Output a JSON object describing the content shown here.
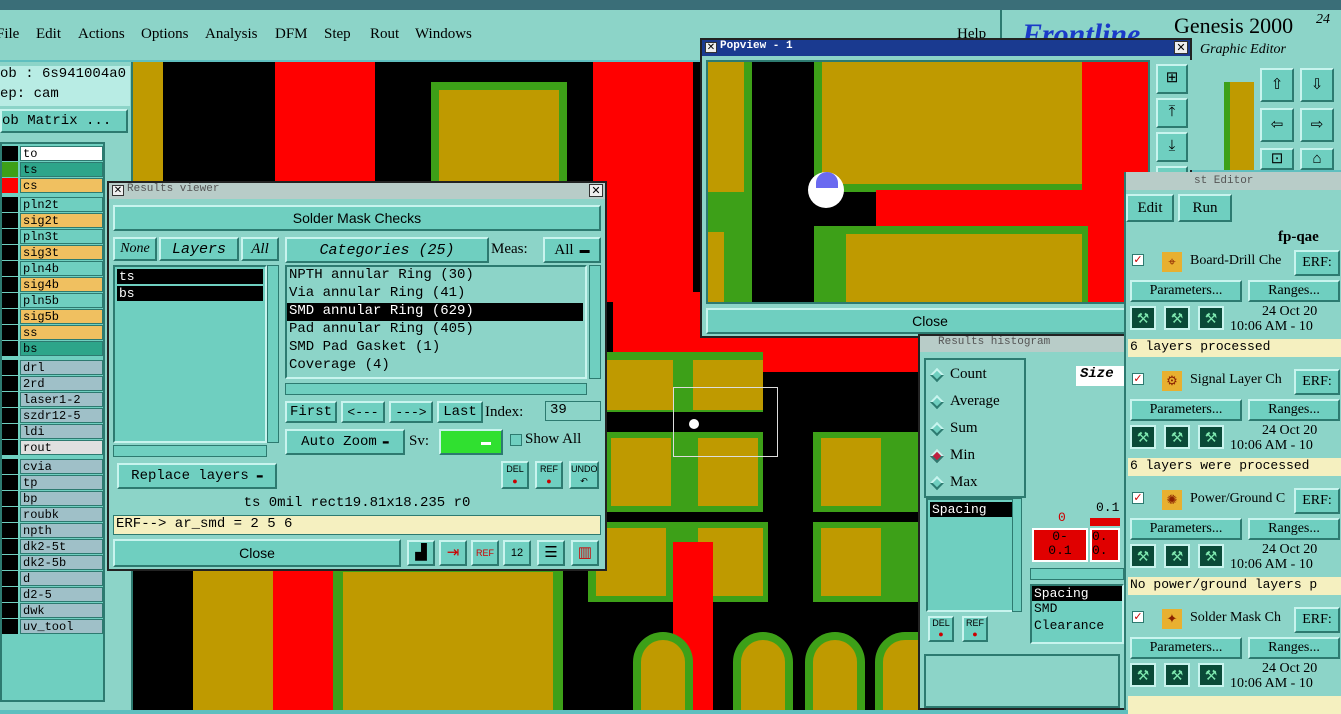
{
  "menubar": {
    "items": [
      "File",
      "Edit",
      "Actions",
      "Options",
      "Analysis",
      "DFM",
      "Step",
      "Rout",
      "Windows"
    ],
    "help": "Help"
  },
  "brand": {
    "logo": "Frontline",
    "product": "Genesis 2000",
    "version": "24",
    "sub": "Graphic Editor"
  },
  "job": {
    "job": "ob : 6s941004a0",
    "step": "ep: cam",
    "matrix": "ob Matrix ..."
  },
  "layers": [
    {
      "name": "to",
      "color": "#ffffff"
    },
    {
      "name": "ts",
      "color": "#2da58a"
    },
    {
      "name": "cs",
      "color": "#f0c060"
    },
    {
      "name": "pln2t",
      "color": "#6fcfc0"
    },
    {
      "name": "sig2t",
      "color": "#f0c060"
    },
    {
      "name": "pln3t",
      "color": "#6fcfc0"
    },
    {
      "name": "sig3t",
      "color": "#f0c060"
    },
    {
      "name": "pln4b",
      "color": "#6fcfc0"
    },
    {
      "name": "sig4b",
      "color": "#f0c060"
    },
    {
      "name": "pln5b",
      "color": "#6fcfc0"
    },
    {
      "name": "sig5b",
      "color": "#f0c060"
    },
    {
      "name": "ss",
      "color": "#f0c060"
    },
    {
      "name": "bs",
      "color": "#2da58a"
    },
    {
      "name": "drl",
      "color": "#9fc0c8"
    },
    {
      "name": "2rd",
      "color": "#9fc0c8"
    },
    {
      "name": "laser1-2",
      "color": "#9fc0c8"
    },
    {
      "name": "szdr12-5",
      "color": "#9fc0c8"
    },
    {
      "name": "ldi",
      "color": "#9fc0c8"
    },
    {
      "name": "rout",
      "color": "#e0e0e0"
    },
    {
      "name": "cvia",
      "color": "#9fc0c8"
    },
    {
      "name": "tp",
      "color": "#9fc0c8"
    },
    {
      "name": "bp",
      "color": "#9fc0c8"
    },
    {
      "name": "roubk",
      "color": "#9fc0c8"
    },
    {
      "name": "npth",
      "color": "#9fc0c8"
    },
    {
      "name": "dk2-5t",
      "color": "#9fc0c8"
    },
    {
      "name": "dk2-5b",
      "color": "#9fc0c8"
    },
    {
      "name": "d",
      "color": "#9fc0c8"
    },
    {
      "name": "d2-5",
      "color": "#9fc0c8"
    },
    {
      "name": "dwk",
      "color": "#9fc0c8"
    },
    {
      "name": "uv_tool",
      "color": "#9fc0c8"
    }
  ],
  "results_viewer": {
    "title": "Results viewer",
    "header": "Solder Mask Checks",
    "none": "None",
    "layers_label": "Layers",
    "all": "All",
    "layer_list": [
      "ts",
      "bs"
    ],
    "categories_label": "Categories (25)",
    "meas_label": "Meas:",
    "meas_value": "All",
    "categories": [
      "NPTH annular Ring (30)",
      "Via annular Ring (41)",
      "SMD annular Ring (629)",
      "Pad annular Ring (405)",
      "SMD Pad Gasket (1)",
      "Coverage (4)"
    ],
    "first": "First",
    "prev": "<---",
    "next": "--->",
    "last": "Last",
    "index_label": "Index:",
    "index_value": "39",
    "auto_zoom": "Auto Zoom",
    "sv_label": "Sv:",
    "show_all": "Show All",
    "replace_layers": "Replace layers",
    "del": "DEL",
    "ref": "REF",
    "undo": "UNDO",
    "status": "ts 0mil   rect19.81x18.235  r0",
    "erf": "ERF--> ar_smd = 2 5 6",
    "close": "Close"
  },
  "popview": {
    "title": "Popview - 1",
    "close": "Close"
  },
  "histogram": {
    "title": "Results histogram",
    "options": [
      "Count",
      "Average",
      "Sum",
      "Min",
      "Max"
    ],
    "selected": "Min",
    "size_label": "Size",
    "list": [
      "Spacing"
    ],
    "list2": [
      "Spacing",
      "SMD",
      "Clearance"
    ],
    "bin_top": [
      "0",
      "0.1"
    ],
    "bin_left": "0-\n0.1",
    "del": "DEL",
    "ref": "REF"
  },
  "checklist": {
    "title": "Checklist Editor",
    "edit": "Edit",
    "run": "Run",
    "name": "fp-qae",
    "items": [
      {
        "name": "Board-Drill Che",
        "erf": "ERF:",
        "params": "Parameters...",
        "ranges": "Ranges...",
        "date": "24 Oct 20",
        "time": "10:06 AM - 10",
        "msg": "6 layers processed"
      },
      {
        "name": "Signal Layer Ch",
        "erf": "ERF:",
        "params": "Parameters...",
        "ranges": "Ranges...",
        "date": "24 Oct 20",
        "time": "10:06 AM - 10",
        "msg": "6 layers were processed"
      },
      {
        "name": "Power/Ground C",
        "erf": "ERF:",
        "params": "Parameters...",
        "ranges": "Ranges...",
        "date": "24 Oct 20",
        "time": "10:06 AM - 10",
        "msg": "No power/ground layers p"
      },
      {
        "name": "Solder Mask Ch",
        "erf": "ERF:",
        "params": "Parameters...",
        "ranges": "Ranges...",
        "date": "24 Oct 20",
        "time": "10:06 AM - 10",
        "msg": ""
      }
    ]
  }
}
